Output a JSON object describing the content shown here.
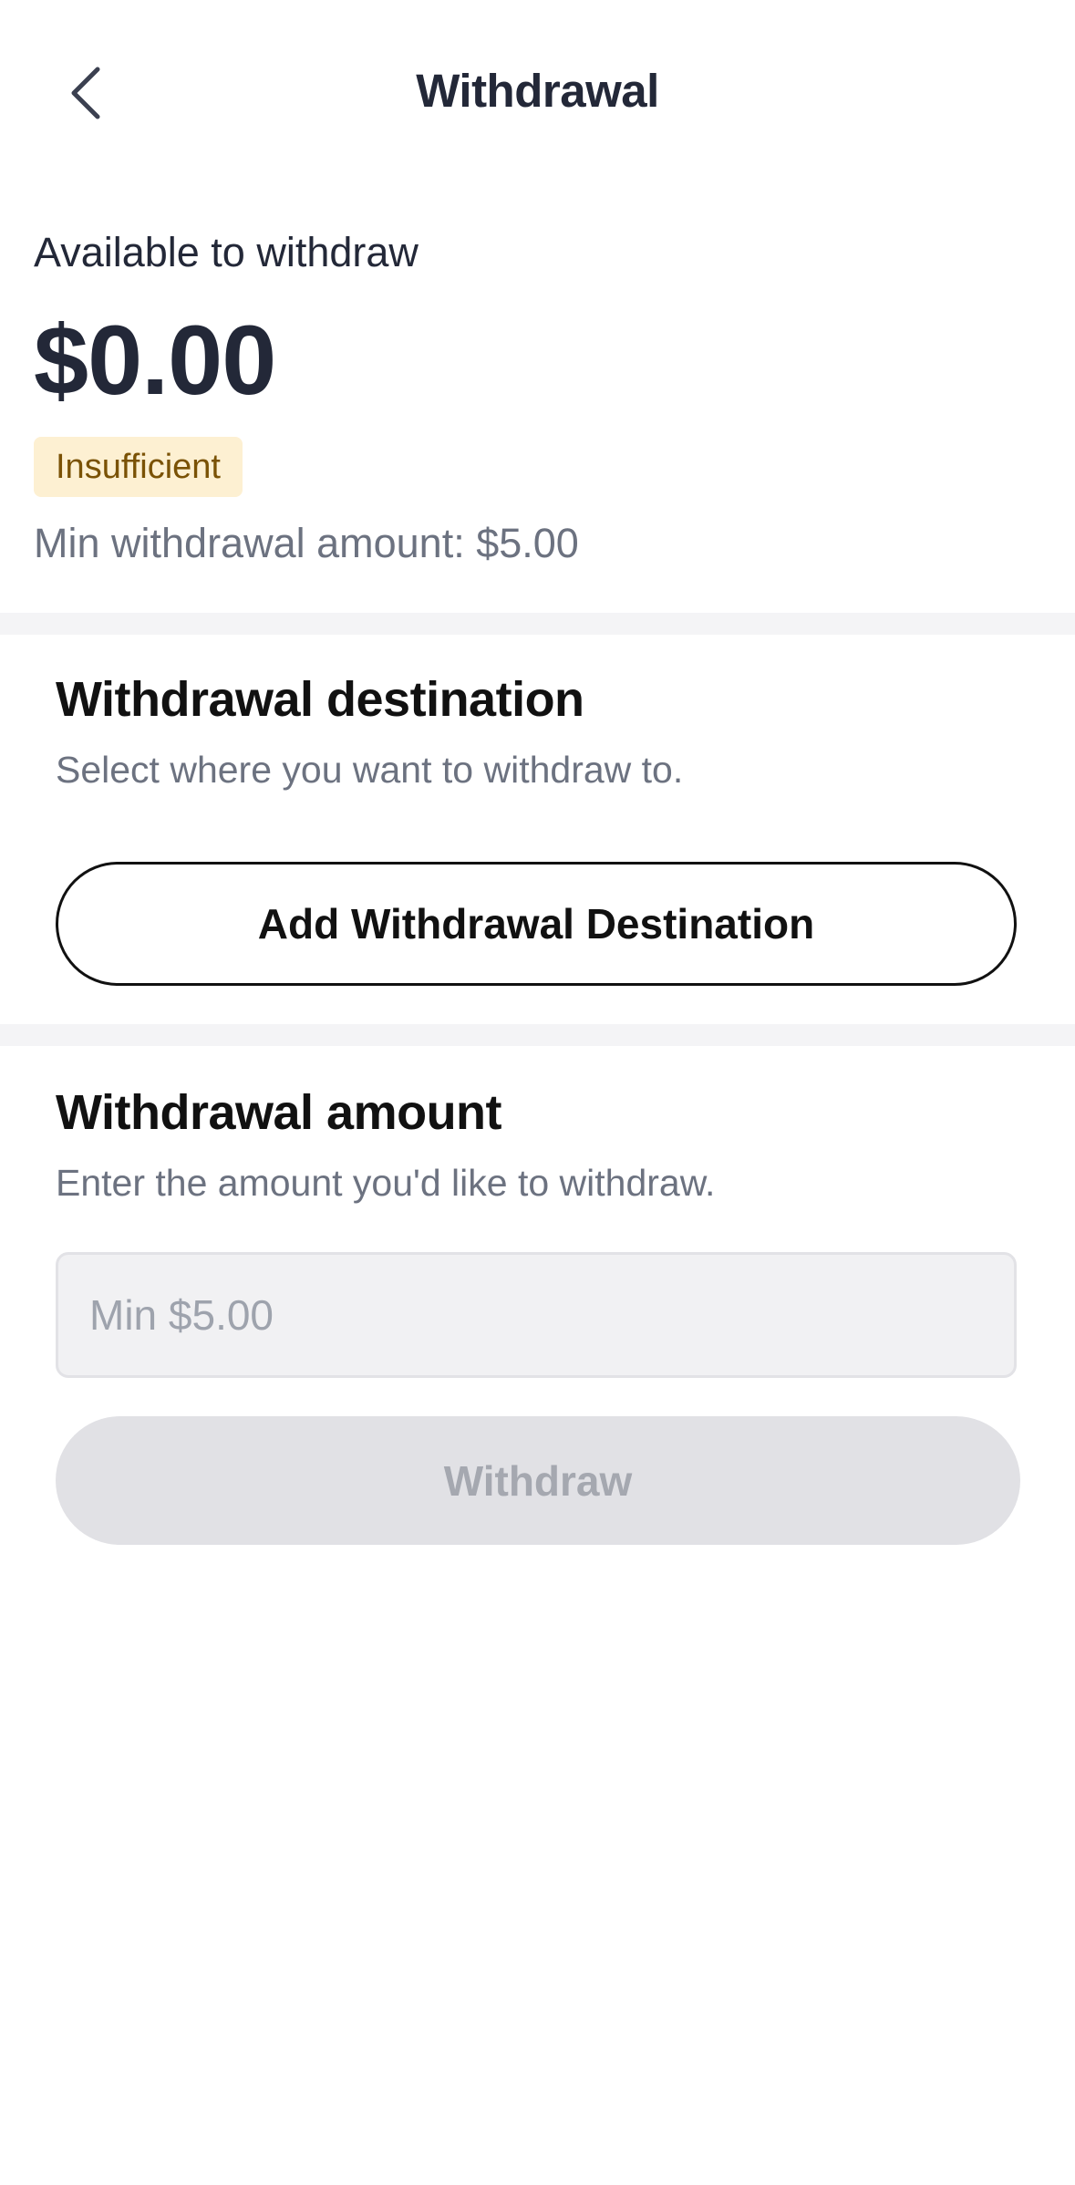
{
  "header": {
    "title": "Withdrawal",
    "back_icon": "chevron-left-icon"
  },
  "balance": {
    "label": "Available to withdraw",
    "amount": "$0.00",
    "status_badge": "Insufficient",
    "min_note": "Min withdrawal amount: $5.00"
  },
  "destination": {
    "title": "Withdrawal destination",
    "subtitle": "Select where you want to withdraw to.",
    "add_button_label": "Add Withdrawal Destination"
  },
  "amount_section": {
    "title": "Withdrawal amount",
    "subtitle": "Enter the amount you'd like to withdraw.",
    "input_value": "",
    "input_placeholder": "Min $5.00",
    "submit_label": "Withdraw"
  },
  "colors": {
    "text_primary": "#232838",
    "text_secondary": "#6c7280",
    "badge_bg": "#fdf0d2",
    "badge_text": "#7a5205",
    "divider": "#f4f4f6",
    "disabled_button_bg": "#e1e1e5",
    "disabled_button_text": "#a5a8b0"
  }
}
